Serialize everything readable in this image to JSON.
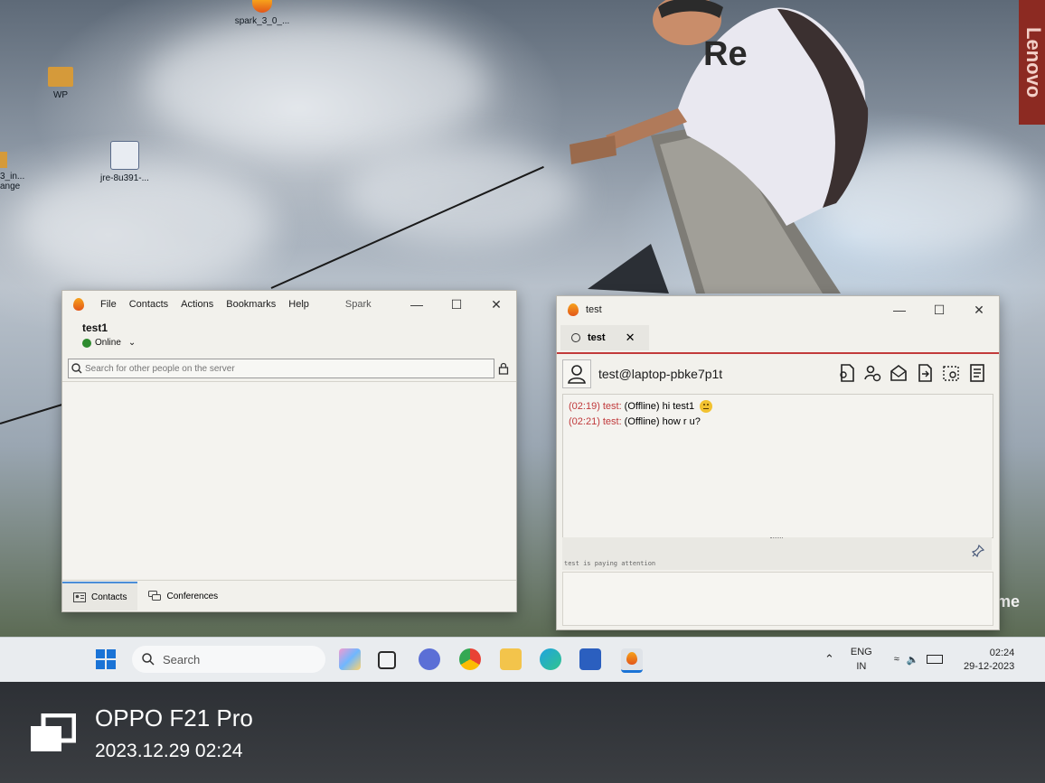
{
  "desktop": {
    "icons": [
      {
        "label": "spark_3_0_..."
      },
      {
        "label": "WP"
      },
      {
        "label": "jre-8u391-..."
      }
    ],
    "brand_tag": "Lenovo",
    "edge_text_left": "3_in...\nange",
    "edge_text_right": "me"
  },
  "spark_window": {
    "menu": [
      "File",
      "Contacts",
      "Actions",
      "Bookmarks",
      "Help"
    ],
    "title": "Spark",
    "user": "test1",
    "status": "Online",
    "search_placeholder": "Search for other people on the server",
    "tabs": [
      "Contacts",
      "Conferences"
    ]
  },
  "chat_window": {
    "title": "test",
    "tab_label": "test",
    "contact": "test@laptop-pbke7p1t",
    "toolbar_icons": [
      "contact-card-icon",
      "add-contact-icon",
      "email-icon",
      "send-file-icon",
      "screenshot-icon",
      "transcript-icon"
    ],
    "messages": [
      {
        "time": "(02:19)",
        "from": "test:",
        "text": "(Offline) hi test1",
        "emoji": "😐"
      },
      {
        "time": "(02:21)",
        "from": "test:",
        "text": "(Offline) how r u?",
        "emoji": ""
      }
    ],
    "typing_note": "test is paying attention",
    "input_value": ""
  },
  "taskbar": {
    "search_placeholder": "Search",
    "language_top": "ENG",
    "language_bottom": "IN",
    "time": "02:24",
    "date": "29-12-2023"
  },
  "watermark": {
    "device": "OPPO F21 Pro",
    "timestamp": "2023.12.29 02:24"
  },
  "colors": {
    "accent_red": "#c0393b",
    "online_green": "#2e8b2e",
    "tab_underline": "#c23b3b",
    "spark_orange": "#f08a1c"
  }
}
